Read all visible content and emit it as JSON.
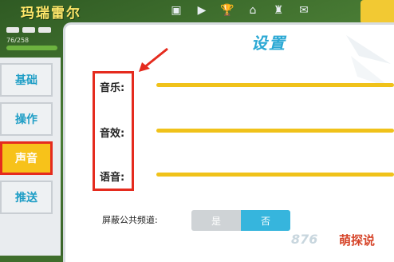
{
  "hud": {
    "player_name": "玛瑞雷尔",
    "exp_text": "76/258",
    "top_icons": [
      "video-icon",
      "play-icon",
      "trophy-icon",
      "home-icon",
      "chess-icon",
      "mail-icon"
    ]
  },
  "sidebar": {
    "items": [
      {
        "label": "基础",
        "active": false
      },
      {
        "label": "操作",
        "active": false
      },
      {
        "label": "声音",
        "active": true
      },
      {
        "label": "推送",
        "active": false
      }
    ]
  },
  "settings": {
    "title": "设置",
    "sliders": [
      {
        "label": "音乐:",
        "value": 1.0
      },
      {
        "label": "音效:",
        "value": 1.0
      },
      {
        "label": "语音:",
        "value": 1.0
      }
    ],
    "mute_public_channel": {
      "label": "屏蔽公共频道:",
      "option_yes": "是",
      "option_no": "否",
      "selected": "否"
    }
  },
  "colors": {
    "accent": "#2aa8d4",
    "slider": "#f0c21a",
    "highlight": "#e52b1e",
    "active_tab": "#f7c21a"
  },
  "watermark": {
    "number": "876",
    "badge": "萌探说"
  }
}
